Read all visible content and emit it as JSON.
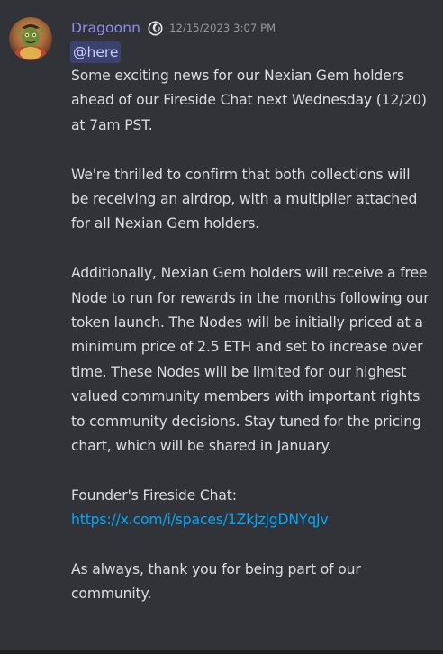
{
  "message": {
    "author": "Dragoonn",
    "timestamp": "12/15/2023 3:07 PM",
    "mention": "@here",
    "paragraphs": [
      "Some exciting news for our Nexian Gem holders ahead of our Fireside Chat next Wednesday (12/20) at 7am PST.",
      "We're thrilled to confirm that both collections will be receiving an airdrop, with a multiplier attached for all Nexian Gem holders.",
      "Additionally, Nexian Gem holders will receive a free Node to run for rewards in the months following our token launch. The Nodes will be initially priced at a minimum price of 2.5 ETH and set to increase over time. These Nodes will be limited for our highest valued community members with important rights to community decisions. Stay tuned for the pricing chart, which will be shared in January.",
      "Founder's Fireside Chat:",
      "As always, thank you for being part of our community."
    ],
    "link": "https://x.com/i/spaces/1ZkJzjgDNYqJv",
    "icons": {
      "avatar": "user-avatar",
      "badge": "role-badge-icon"
    },
    "colors": {
      "background": "#323339",
      "username": "#8c8cf0",
      "mention_bg": "#3c4270",
      "link": "#00a8fc"
    }
  }
}
